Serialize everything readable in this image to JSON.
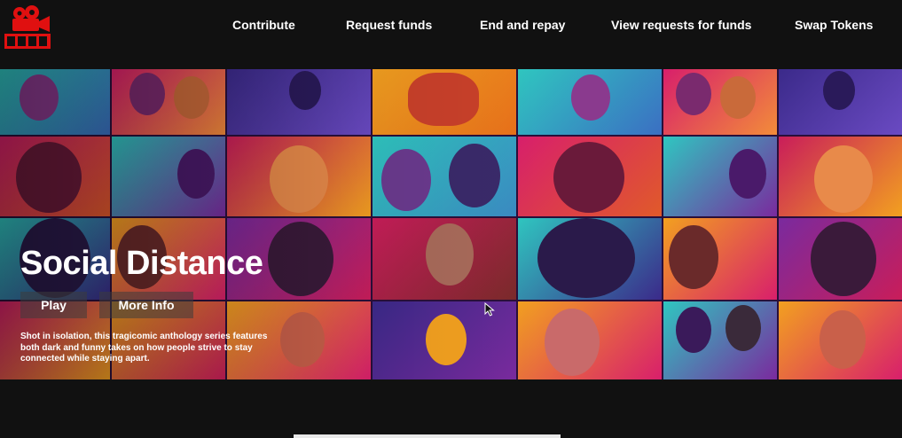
{
  "nav": {
    "logo_icon": "film-camera-icon",
    "links": [
      "Contribute",
      "Request funds",
      "End and repay",
      "View requests for funds",
      "Swap Tokens"
    ]
  },
  "hero": {
    "title": "Social Distance",
    "play_label": "Play",
    "info_label": "More Info",
    "description": "Shot in isolation, this tragicomic anthology series features both dark and funny takes on how people strive to stay connected while staying apart."
  },
  "colors": {
    "background": "#111111",
    "logo_red": "#e01010",
    "tile_palette": [
      "#d81f6b",
      "#7a2a9e",
      "#2fc6c0",
      "#f2a020",
      "#c91d5a",
      "#3b2a8a"
    ]
  }
}
